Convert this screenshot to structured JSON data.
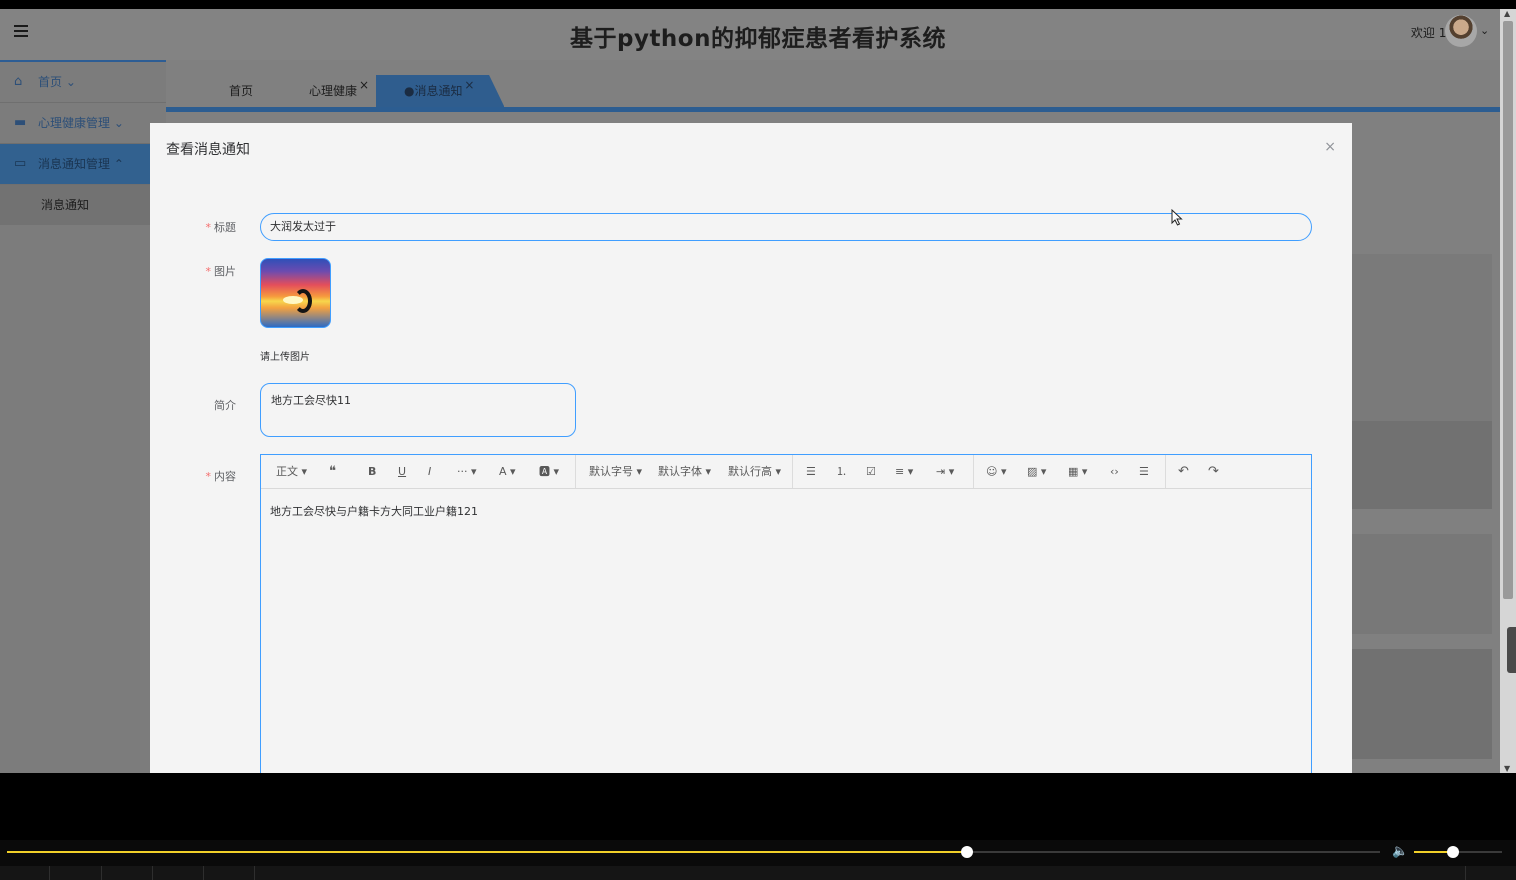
{
  "app": {
    "title": "基于python的抑郁症患者看护系统",
    "welcome": "欢迎 11",
    "avatar_chevron": "⌄"
  },
  "sidebar": {
    "items": [
      {
        "label": "首页 ⌄",
        "icon": "home-icon"
      },
      {
        "label": "心理健康管理 ⌄",
        "icon": "briefcase-icon"
      },
      {
        "label": "消息通知管理 ⌃",
        "icon": "wallet-icon"
      }
    ],
    "sub_items": [
      {
        "label": "消息通知"
      }
    ]
  },
  "tabs": [
    {
      "label": "首页"
    },
    {
      "label": "心理健康",
      "close": "×"
    },
    {
      "label": "●消息通知",
      "close": "×"
    }
  ],
  "modal": {
    "title": "查看消息通知",
    "close": "×",
    "fields": {
      "title_label": "标题",
      "title_value": "大润发太过于",
      "image_label": "图片",
      "upload_hint": "请上传图片",
      "summary_label": "简介",
      "summary_value": "地方工会尽快11",
      "content_label": "内容",
      "content_value": "地方工会尽快与户籍卡方大同工业户籍121"
    },
    "required_mark": "*",
    "toolbar": {
      "paragraph": "正文 ▾",
      "quote": "❝",
      "bold": "B",
      "underline": "U",
      "italic": "I",
      "more": "··· ▾",
      "font_color": "A ▾",
      "bg_color": "🅰 ▾",
      "font_size": "默认字号 ▾",
      "font_family": "默认字体 ▾",
      "line_height": "默认行高 ▾",
      "bullet_list": "☰",
      "ordered_list": "⒈",
      "todo": "☑",
      "align": "≡ ▾",
      "indent": "⇥ ▾",
      "emoji": "☺ ▾",
      "image": "▨ ▾",
      "table": "▦ ▾",
      "code": "‹›",
      "divider": "☰",
      "undo": "↶",
      "redo": "↷"
    }
  },
  "player": {
    "progress": 0.699,
    "volume": 0.44,
    "volume_icon": "🔈"
  },
  "colors": {
    "accent": "#409eff",
    "progress": "#f1d029",
    "sidebar_active": "#32618f"
  }
}
